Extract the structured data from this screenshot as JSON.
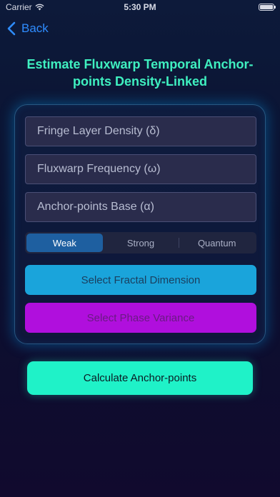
{
  "status_bar": {
    "carrier": "Carrier",
    "time": "5:30 PM"
  },
  "nav": {
    "back_label": "Back"
  },
  "title": "Estimate Fluxwarp Temporal Anchor-points Density-Linked",
  "form": {
    "fields": [
      {
        "placeholder": "Fringe Layer Density (δ)",
        "value": ""
      },
      {
        "placeholder": "Fluxwarp Frequency (ω)",
        "value": ""
      },
      {
        "placeholder": "Anchor-points Base (α)",
        "value": ""
      }
    ],
    "segments": [
      "Weak",
      "Strong",
      "Quantum"
    ],
    "selected_segment": "Weak",
    "fractal_button": "Select Fractal Dimension",
    "phase_button": "Select Phase Variance"
  },
  "calculate_button": "Calculate Anchor-points",
  "colors": {
    "title": "#3ff0c0",
    "back": "#2f8cff",
    "fractal_button": "#1aa4db",
    "phase_button": "#b00fdd",
    "calculate_button": "#1ff2c8",
    "segment_selected": "#1e5fa0"
  },
  "icons": {
    "back": "chevron-left-icon",
    "wifi": "wifi-icon",
    "battery": "battery-icon"
  }
}
